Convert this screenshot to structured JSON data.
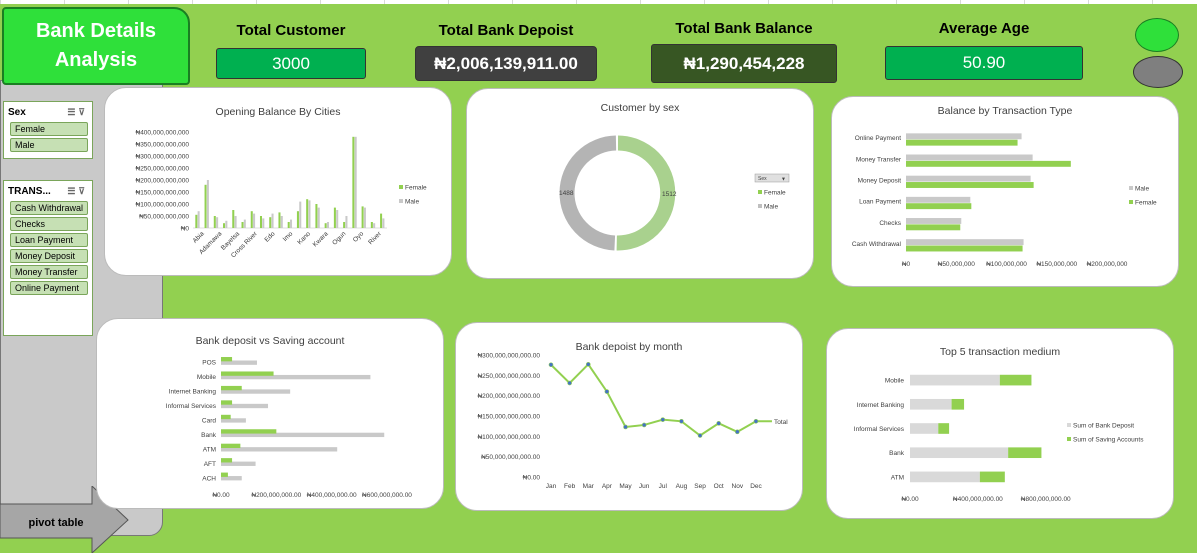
{
  "dashboard": {
    "title": "Bank Details\nAnalysis",
    "kpis": [
      {
        "label": "Total Customer",
        "value": "3000"
      },
      {
        "label": "Total Bank Depoist",
        "value": "₦2,006,139,911.00"
      },
      {
        "label": "Total Bank Balance",
        "value": "₦1,290,454,228"
      },
      {
        "label": "Average Age",
        "value": "50.90"
      }
    ],
    "colors": {
      "background": "#92d050",
      "female": "#92d050",
      "male": "#c9c9c9",
      "kpi_green": "#00b050",
      "kpi_gray": "#404040",
      "kpi_dark": "#375623"
    }
  },
  "slicers": {
    "sex": {
      "title": "Sex",
      "items": [
        "Female",
        "Male"
      ]
    },
    "transaction": {
      "title": "TRANS...",
      "items": [
        "Cash Withdrawal",
        "Checks",
        "Loan Payment",
        "Money Deposit",
        "Money Transfer",
        "Online Payment"
      ]
    },
    "icons": [
      "multi-select-icon",
      "clear-filter-icon"
    ]
  },
  "pivot_button": {
    "label": "pivot table"
  },
  "chart_data": [
    {
      "id": "opening-balance",
      "type": "bar",
      "title": "Opening Balance By Cities",
      "yticks": [
        "₦400,000,000,000",
        "₦350,000,000,000",
        "₦300,000,000,000",
        "₦250,000,000,000",
        "₦200,000,000,000",
        "₦150,000,000,000",
        "₦100,000,000,000",
        "₦50,000,000,000",
        "₦0"
      ],
      "ylim": [
        0,
        400000000000
      ],
      "categories": [
        "Abia",
        "",
        "Adamawa",
        "",
        "Bayelsa",
        "Cross River",
        "",
        "Edo",
        "",
        "Imo",
        "",
        "Kano",
        "",
        "Kwara",
        "",
        "Ogun",
        "",
        "Oyo",
        "",
        "River",
        ""
      ],
      "xlabels": [
        "Abia",
        "Adamawa",
        "Bayelsa",
        "Cross River",
        "Edo",
        "Imo",
        "Kano",
        "Kwara",
        "Ogun",
        "Oyo",
        "River"
      ],
      "series": [
        {
          "name": "Female",
          "values": [
            55000000000,
            180000000000,
            50000000000,
            20000000000,
            75000000000,
            25000000000,
            70000000000,
            50000000000,
            45000000000,
            65000000000,
            25000000000,
            70000000000,
            120000000000,
            100000000000,
            20000000000,
            85000000000,
            25000000000,
            380000000000,
            90000000000,
            25000000000,
            60000000000
          ]
        },
        {
          "name": "Male",
          "values": [
            70000000000,
            200000000000,
            45000000000,
            30000000000,
            50000000000,
            35000000000,
            60000000000,
            40000000000,
            60000000000,
            50000000000,
            35000000000,
            110000000000,
            115000000000,
            85000000000,
            25000000000,
            75000000000,
            50000000000,
            380000000000,
            85000000000,
            20000000000,
            40000000000
          ]
        }
      ]
    },
    {
      "id": "customer-by-sex",
      "type": "pie",
      "title": "Customer by sex",
      "legend_title": "Sex",
      "series": [
        {
          "name": "Female",
          "value": 1512
        },
        {
          "name": "Male",
          "value": 1488
        }
      ],
      "labels": [
        "1512",
        "1488"
      ]
    },
    {
      "id": "balance-by-transaction",
      "type": "bar",
      "title": "Balance by Transaction Type",
      "categories": [
        "Online Payment",
        "Money Transfer",
        "Money Deposit",
        "Loan Payment",
        "Checks",
        "Cash Withdrawal"
      ],
      "series": [
        {
          "name": "Male",
          "values": [
            115000000000,
            126000000000,
            124000000000,
            64000000000,
            55000000000,
            117000000000
          ]
        },
        {
          "name": "Female",
          "values": [
            111000000000,
            164000000000,
            127000000000,
            65000000000,
            54000000000,
            116000000000
          ]
        }
      ],
      "xticks": [
        "₦0",
        "₦50,000,000",
        "₦100,000,000",
        "₦150,000,000",
        "₦200,000,000"
      ],
      "xlim": [
        0,
        200000000000
      ]
    },
    {
      "id": "deposit-vs-saving",
      "type": "bar",
      "title": "Bank deposit vs Saving account",
      "categories": [
        "POS",
        "Mobile",
        "Internet Banking",
        "Informal Services",
        "Card",
        "Bank",
        "ATM",
        "AFT",
        "ACH"
      ],
      "series": [
        {
          "name": "Bank Deposit",
          "values": [
            130000000,
            540000000,
            250000000,
            170000000,
            90000000,
            590000000,
            420000000,
            125000000,
            75000000
          ]
        },
        {
          "name": "Saving Account",
          "values": [
            40000000,
            190000000,
            75000000,
            40000000,
            35000000,
            200000000,
            70000000,
            40000000,
            25000000
          ]
        }
      ],
      "xticks": [
        "₦0.00",
        "₦200,000,000.00",
        "₦400,000,000.00",
        "₦600,000,000.00"
      ],
      "xlim": [
        0,
        600000000
      ]
    },
    {
      "id": "deposit-by-month",
      "type": "line",
      "title": "Bank depoist by month",
      "categories": [
        "Jan",
        "Feb",
        "Mar",
        "Apr",
        "May",
        "Jun",
        "Jul",
        "Aug",
        "Sep",
        "Oct",
        "Nov",
        "Dec"
      ],
      "series": [
        {
          "name": "Total",
          "values": [
            276000000000,
            231000000000,
            277000000000,
            210000000000,
            123000000000,
            128000000000,
            141000000000,
            137000000000,
            102000000000,
            132000000000,
            111000000000,
            137000000000
          ]
        }
      ],
      "yticks": [
        "₦300,000,000,000.00",
        "₦250,000,000,000.00",
        "₦200,000,000,000.00",
        "₦150,000,000,000.00",
        "₦100,000,000,000.00",
        "₦50,000,000,000.00",
        "₦0.00"
      ],
      "ylim": [
        0,
        300000000000
      ]
    },
    {
      "id": "top5-medium",
      "type": "bar",
      "title": "Top 5 transaction medium",
      "categories": [
        "Mobile",
        "Internet Banking",
        "Informal Services",
        "Bank",
        "ATM"
      ],
      "series": [
        {
          "name": "Sum of Bank Deposit",
          "values": [
            540000000,
            250000000,
            170000000,
            590000000,
            420000000
          ]
        },
        {
          "name": "Sum of Saving Accounts",
          "values": [
            190000000,
            75000000,
            65000000,
            200000000,
            150000000
          ]
        }
      ],
      "xticks": [
        "₦0.00",
        "₦400,000,000.00",
        "₦800,000,000.00"
      ],
      "xlim": [
        0,
        1100000000
      ]
    }
  ]
}
